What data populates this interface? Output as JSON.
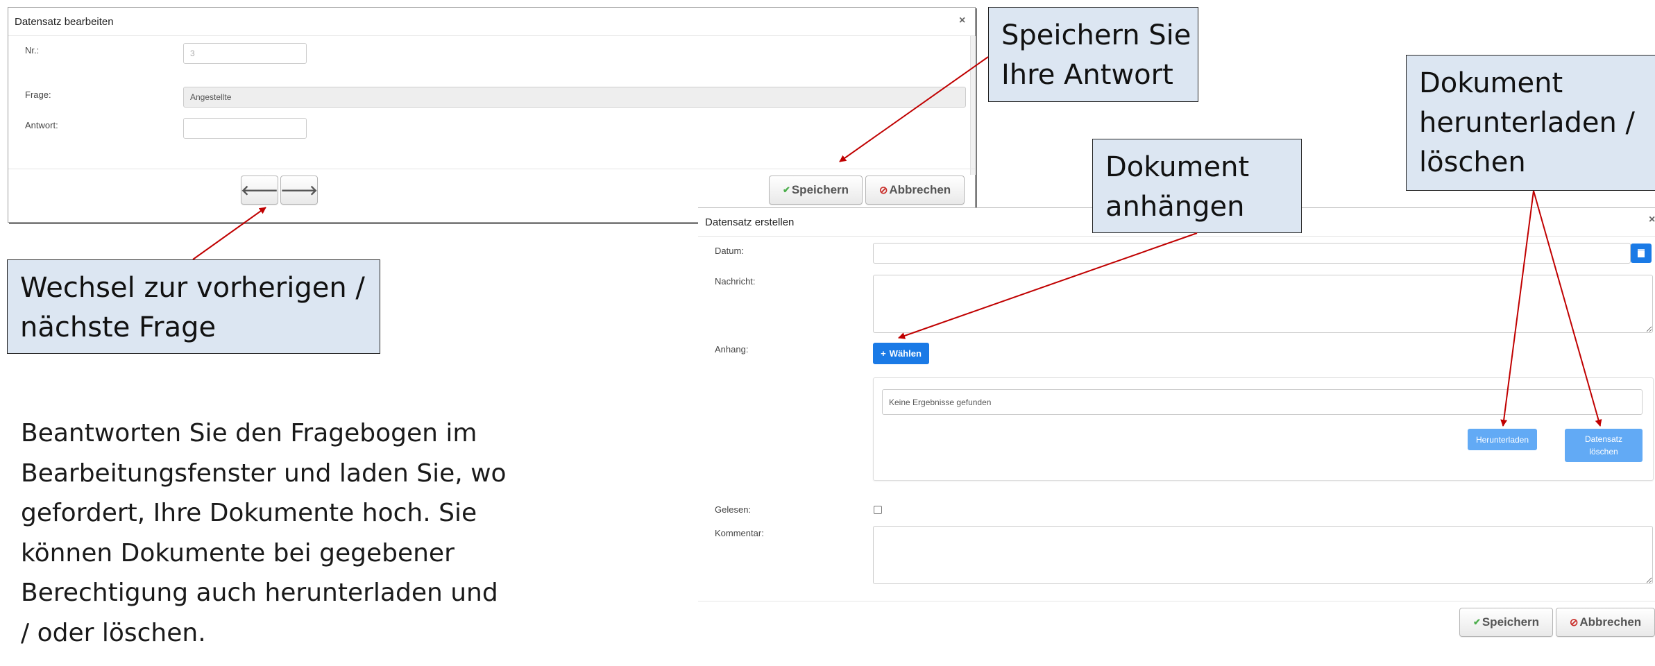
{
  "colors": {
    "callout_bg": "#dce6f2",
    "arrow": "#c00000",
    "primary_blue": "#1a7ae6",
    "light_blue": "#62aaf5",
    "check_green": "#4cae4c",
    "cancel_red": "#c9302c"
  },
  "edit_dialog": {
    "title": "Datensatz bearbeiten",
    "close_icon": "×",
    "fields": {
      "nr_label": "Nr.:",
      "nr_value": "3",
      "frage_label": "Frage:",
      "frage_value": "Angestellte",
      "antwort_label": "Antwort:",
      "antwort_value": ""
    },
    "prev_icon": "🡐",
    "next_icon": "🡒",
    "save_label": "Speichern",
    "cancel_label": "Abbrechen"
  },
  "create_dialog": {
    "title": "Datensatz erstellen",
    "close_icon": "×",
    "datum_label": "Datum:",
    "datum_value": "",
    "calendar_icon": "calendar-icon",
    "nachricht_label": "Nachricht:",
    "anhang_label": "Anhang:",
    "choose_label": "Wählen",
    "choose_icon": "+",
    "no_results": "Keine Ergebnisse gefunden",
    "download_label": "Herunterladen",
    "delete_label_line1": "Datensatz",
    "delete_label_line2": "löschen",
    "gelesen_label": "Gelesen:",
    "gelesen_checked": false,
    "kommentar_label": "Kommentar:",
    "save_label": "Speichern",
    "cancel_label": "Abbrechen"
  },
  "callouts": {
    "save_answer": [
      "Speichern Sie",
      "Ihre Antwort"
    ],
    "download_delete": [
      "Dokument",
      "herunterladen /",
      "löschen"
    ],
    "attach": [
      "Dokument",
      "anhängen"
    ],
    "navigate": [
      "Wechsel zur vorherigen /",
      "nächste Frage"
    ]
  },
  "description": [
    "Beantworten Sie den Fragebogen im",
    "Bearbeitungsfenster und laden Sie, wo",
    "gefordert, Ihre Dokumente hoch. Sie",
    "können Dokumente bei gegebener",
    "Berechtigung auch herunterladen und",
    "/ oder löschen."
  ]
}
